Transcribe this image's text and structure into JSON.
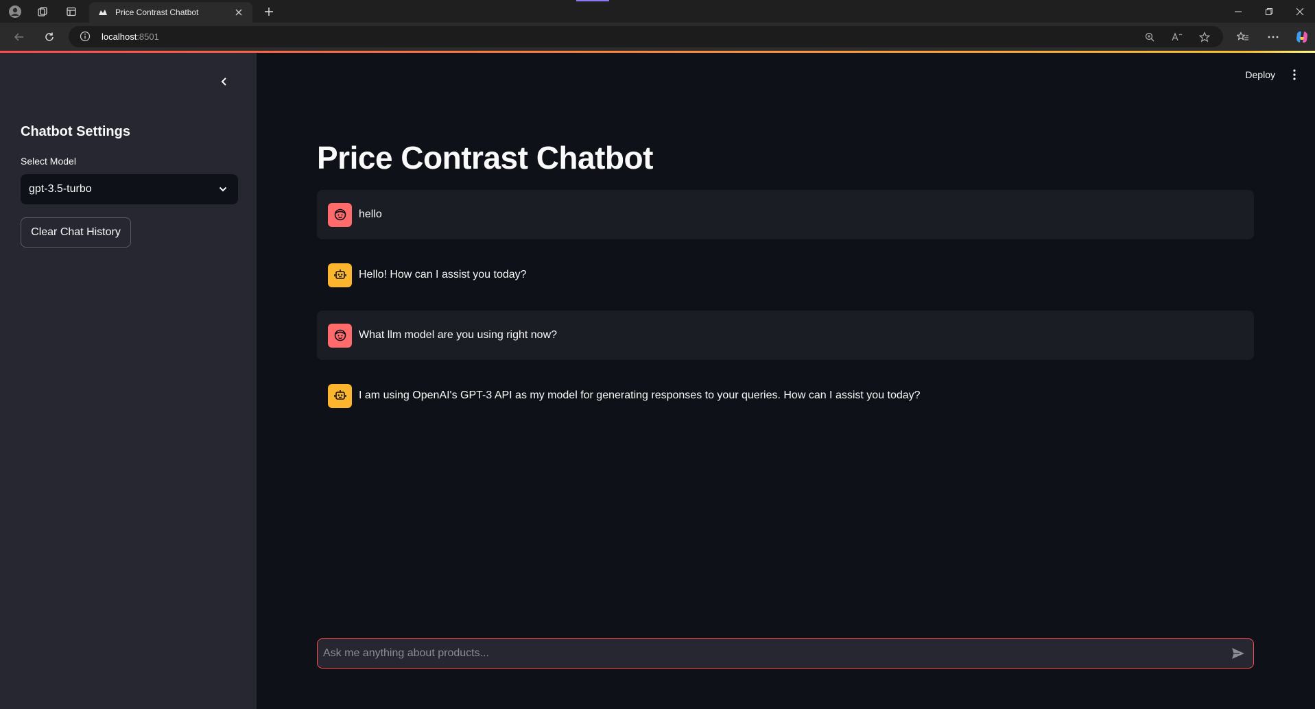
{
  "browser": {
    "tab_title": "Price Contrast Chatbot",
    "url_host": "localhost",
    "url_port": ":8501"
  },
  "sidebar": {
    "title": "Chatbot Settings",
    "model_label": "Select Model",
    "model_value": "gpt-3.5-turbo",
    "clear_button": "Clear Chat History"
  },
  "header": {
    "deploy": "Deploy"
  },
  "main": {
    "title": "Price Contrast Chatbot",
    "messages": [
      {
        "role": "user",
        "text": "hello"
      },
      {
        "role": "assistant",
        "text": "Hello! How can I assist you today?"
      },
      {
        "role": "user",
        "text": "What llm model are you using right now?"
      },
      {
        "role": "assistant",
        "text": "I am using OpenAI's GPT-3 API as my model for generating responses to your queries. How can I assist you today?"
      }
    ],
    "input_placeholder": "Ask me anything about products..."
  },
  "colors": {
    "accent": "#ff4b4b",
    "user_avatar": "#ff6b6b",
    "bot_avatar": "#fdb52e",
    "background": "#0e1117",
    "sidebar": "#262730"
  }
}
